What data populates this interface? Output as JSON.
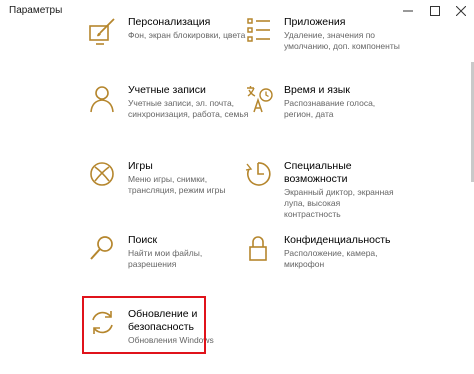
{
  "window": {
    "title": "Параметры",
    "controls": [
      "minimize-icon",
      "maximize-icon",
      "close-icon"
    ]
  },
  "accent_color": "#b5862d",
  "tiles": [
    {
      "icon": "personalization-icon",
      "label": "Персонализация",
      "desc_lines": [
        "Фон, экран блокировки, цвета"
      ]
    },
    {
      "icon": "apps-icon",
      "label": "Приложения",
      "desc_lines": [
        "Удаление, значения по",
        "умолчанию, доп. компоненты"
      ]
    },
    {
      "icon": "accounts-icon",
      "label": "Учетные записи",
      "desc_lines": [
        "Учетные записи, эл. почта,",
        "синхронизация, работа, семья"
      ]
    },
    {
      "icon": "time-language-icon",
      "label": "Время и язык",
      "desc_lines": [
        "Распознавание голоса,",
        "регион, дата"
      ]
    },
    {
      "icon": "gaming-icon",
      "label": "Игры",
      "desc_lines": [
        "Меню игры, снимки,",
        "трансляция, режим игры"
      ]
    },
    {
      "icon": "ease-of-access-icon",
      "label": "Специальные",
      "label2": "возможности",
      "desc_lines": [
        "Экранный диктор, экранная",
        "лупа, высокая",
        "контрастность"
      ]
    },
    {
      "icon": "search-icon",
      "label": "Поиск",
      "desc_lines": [
        "Найти мои файлы,",
        "разрешения"
      ]
    },
    {
      "icon": "privacy-lock-icon",
      "label": "Конфиденциальность",
      "desc_lines": [
        "Расположение, камера,",
        "микрофон"
      ]
    },
    {
      "icon": "update-security-icon",
      "label": "Обновление и",
      "label2": "безопасность",
      "desc_lines": [
        "Обновления Windows"
      ]
    }
  ]
}
